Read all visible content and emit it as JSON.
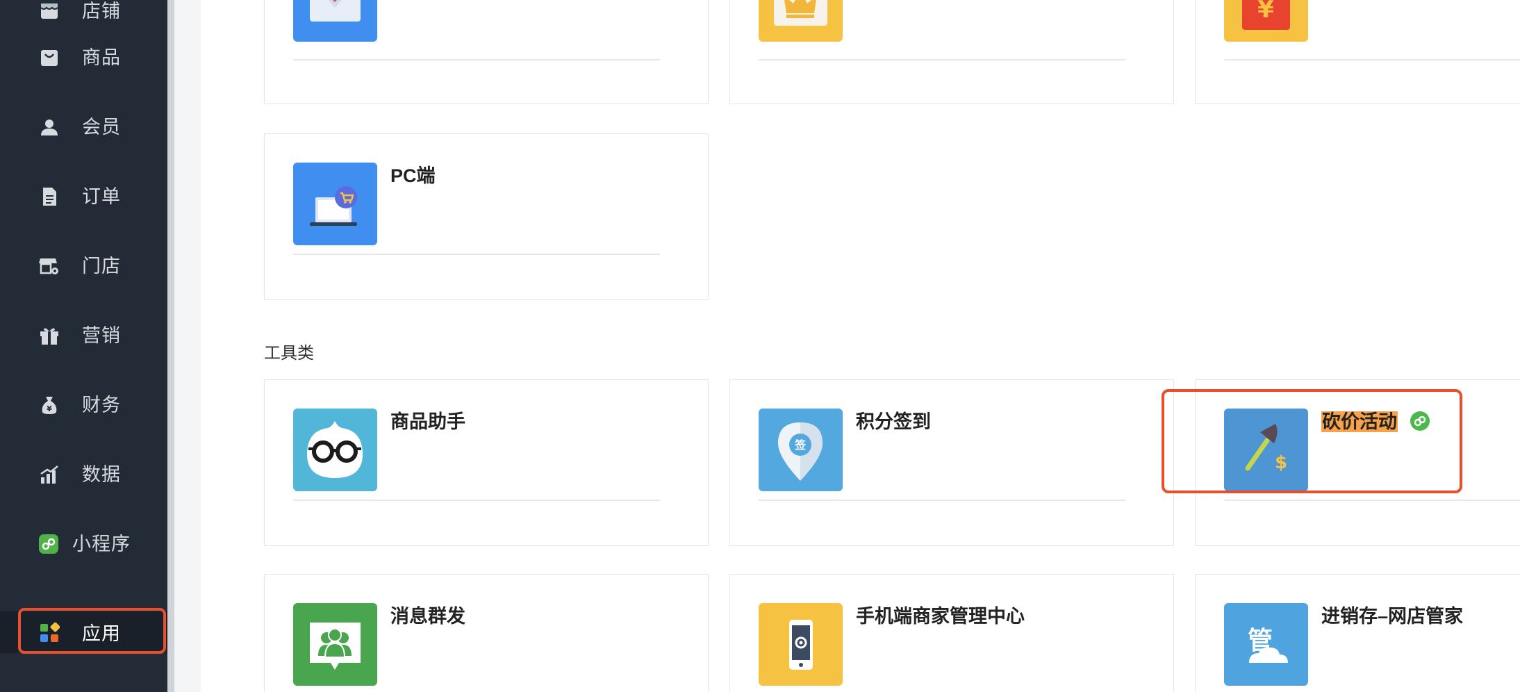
{
  "sidebar": {
    "items": [
      {
        "label": "店铺",
        "icon": "shop-icon"
      },
      {
        "label": "商品",
        "icon": "bag-icon"
      },
      {
        "label": "会员",
        "icon": "user-icon"
      },
      {
        "label": "订单",
        "icon": "document-icon"
      },
      {
        "label": "门店",
        "icon": "store-settings-icon"
      },
      {
        "label": "营销",
        "icon": "gift-icon"
      },
      {
        "label": "财务",
        "icon": "money-bag-icon"
      },
      {
        "label": "数据",
        "icon": "bar-chart-icon"
      },
      {
        "label": "小程序",
        "icon": "mini-program-icon"
      },
      {
        "label": "应用",
        "icon": "apps-grid-icon",
        "active": true
      }
    ]
  },
  "sections": {
    "tools_title": "工具类"
  },
  "cards": {
    "top_row": [
      {
        "name": "",
        "icon": "red-heart-envelope-icon",
        "color": "#3f8ef0"
      },
      {
        "name": "",
        "icon": "crown-icon",
        "color": "#f5c242"
      },
      {
        "name": "",
        "icon": "red-envelope-yuan-icon",
        "color": "#f5c242"
      }
    ],
    "pc": {
      "name": "PC端",
      "icon": "laptop-cart-icon",
      "color": "#3f8ef0"
    },
    "tools_row1": [
      {
        "name": "商品助手",
        "icon": "glasses-mascot-icon",
        "color": "#52b6d8"
      },
      {
        "name": "积分签到",
        "icon": "checkin-pin-icon",
        "color": "#53a8e0"
      },
      {
        "name": "砍价活动",
        "icon": "axe-dollar-icon",
        "color": "#4d96d3"
      }
    ],
    "tools_row2": [
      {
        "name": "消息群发",
        "icon": "group-message-icon",
        "color": "#4aa54f"
      },
      {
        "name": "手机端商家管理中心",
        "icon": "mobile-settings-icon",
        "color": "#f5c242"
      },
      {
        "name": "进销存–网店管家",
        "icon": "manager-cloud-icon",
        "color": "#4fa3df"
      }
    ]
  },
  "colors": {
    "sidebar_bg": "#232b36",
    "accent_red": "#e94f2a",
    "highlight": "#f7a24a"
  }
}
